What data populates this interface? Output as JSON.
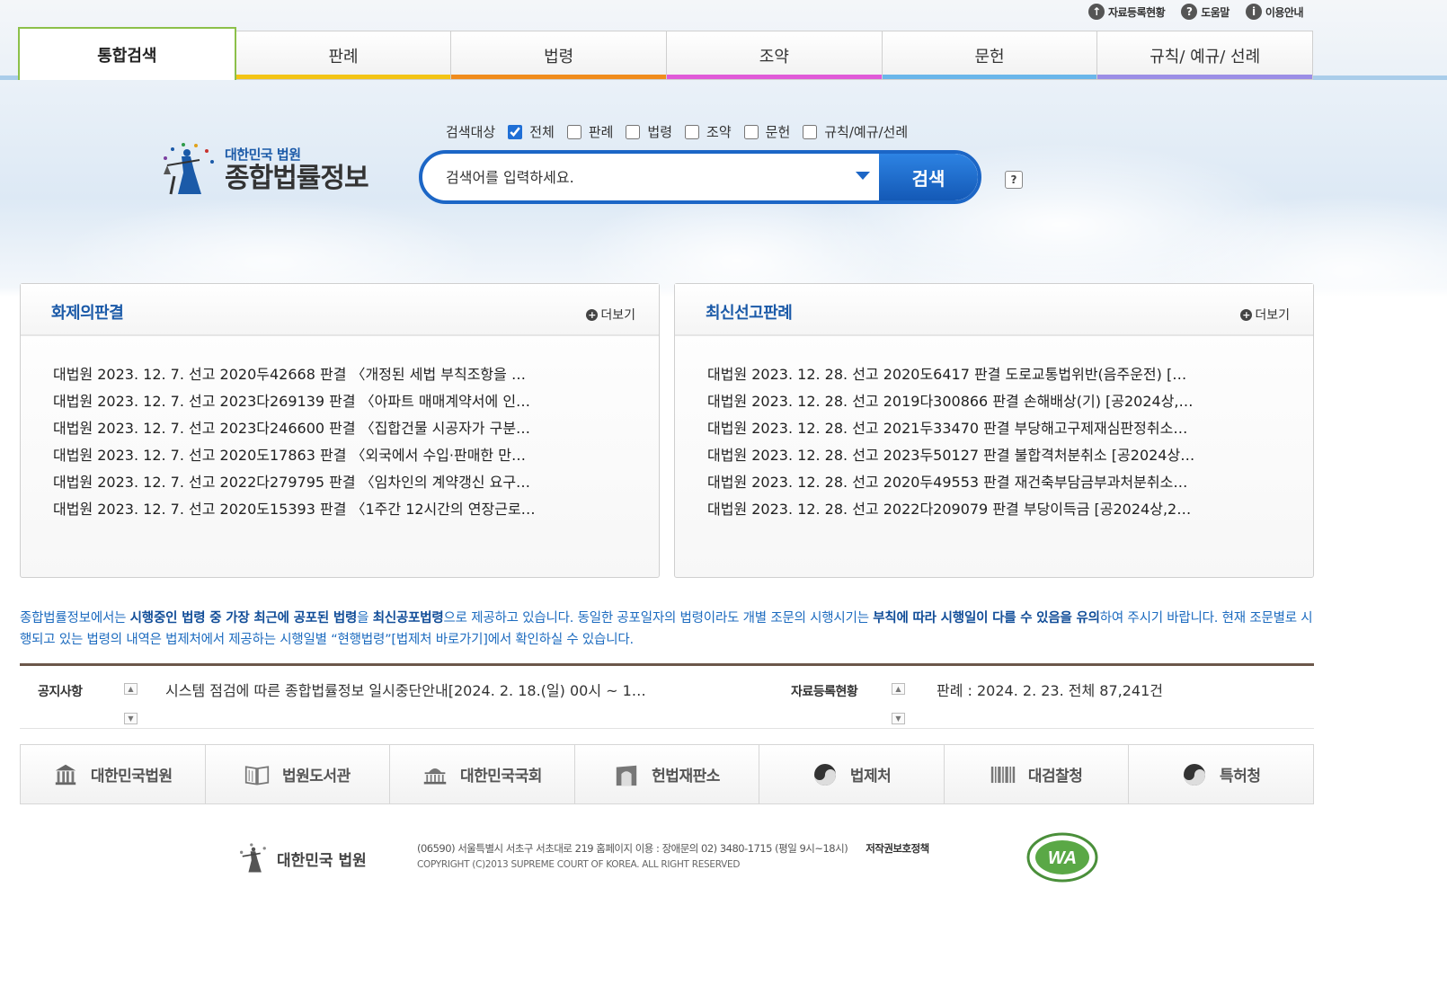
{
  "util": [
    {
      "label": "자료등록현황",
      "icon": "upload-icon"
    },
    {
      "label": "도움말",
      "icon": "question-icon"
    },
    {
      "label": "이용안내",
      "icon": "info-icon"
    }
  ],
  "tabs": [
    {
      "label": "통합검색",
      "color": "#8cc04a",
      "active": true
    },
    {
      "label": "판례",
      "color": "#f3c415"
    },
    {
      "label": "법령",
      "color": "#f08c1c"
    },
    {
      "label": "조약",
      "color": "#e05ad8"
    },
    {
      "label": "문헌",
      "color": "#6ab6ea"
    },
    {
      "label": "규칙/ 예규/ 선례",
      "color": "#9b8ee6"
    }
  ],
  "logo": {
    "sub": "대한민국 법원",
    "main": "종합법률정보"
  },
  "search": {
    "target_label": "검색대상",
    "targets": [
      {
        "label": "전체",
        "checked": true
      },
      {
        "label": "판례",
        "checked": false
      },
      {
        "label": "법령",
        "checked": false
      },
      {
        "label": "조약",
        "checked": false
      },
      {
        "label": "문헌",
        "checked": false
      },
      {
        "label": "규칙/예규/선례",
        "checked": false
      }
    ],
    "placeholder": "검색어를 입력하세요.",
    "button": "검색",
    "help": "?"
  },
  "panels": {
    "topical": {
      "title": "화제의판결",
      "more": "더보기",
      "items": [
        "대법원 2023. 12. 7. 선고 2020두42668 판결 〈개정된 세법 부칙조항을 …",
        "대법원 2023. 12. 7. 선고 2023다269139 판결 〈아파트 매매계약서에 인…",
        "대법원 2023. 12. 7. 선고 2023다246600 판결 〈집합건물 시공자가 구분…",
        "대법원 2023. 12. 7. 선고 2020도17863 판결 〈외국에서 수입·판매한 만…",
        "대법원 2023. 12. 7. 선고 2022다279795 판결 〈임차인의 계약갱신 요구…",
        "대법원 2023. 12. 7. 선고 2020도15393 판결 〈1주간 12시간의 연장근로…"
      ]
    },
    "latest": {
      "title": "최신선고판례",
      "more": "더보기",
      "items": [
        "대법원 2023. 12. 28. 선고 2020도6417 판결 도로교통법위반(음주운전) […",
        "대법원 2023. 12. 28. 선고 2019다300866 판결 손해배상(기) [공2024상,…",
        "대법원 2023. 12. 28. 선고 2021두33470 판결 부당해고구제재심판정취소…",
        "대법원 2023. 12. 28. 선고 2023두50127 판결 불합격처분취소 [공2024상…",
        "대법원 2023. 12. 28. 선고 2020두49553 판결 재건축부담금부과처분취소…",
        "대법원 2023. 12. 28. 선고 2022다209079 판결 부당이득금 [공2024상,2…"
      ]
    }
  },
  "info_text": {
    "p1": "종합법률정보에서는 ",
    "b1": "시행중인 법령 중 가장 최근에 공포된 법령",
    "p2": "을 ",
    "b2": "최신공포법령",
    "p3": "으로 제공하고 있습니다. 동일한 공포일자의 법령이라도 개별 조문의 시행시기는 ",
    "b3": "부칙에 따라 시행일이 다를 수 있음을 유의",
    "p4": "하여 주시기 바랍니다. 현재 조문별로 시행되고 있는 법령의 내역은 법제처에서 제공하는 시행일별 “현행법령”[법제처 바로가기]에서 확인하실 수 있습니다."
  },
  "notices": {
    "notice_label": "공지사항",
    "notice_text": "시스템 점검에 따른 종합법률정보 일시중단안내[2024. 2. 18.(일) 00시 ~ 1…",
    "reg_label": "자료등록현황",
    "reg_text": "판례 : 2024. 2. 23. 전체 87,241건"
  },
  "sites": [
    {
      "label": "대한민국법원",
      "icon": "court-building-icon"
    },
    {
      "label": "법원도서관",
      "icon": "book-icon"
    },
    {
      "label": "대한민국국회",
      "icon": "assembly-building-icon"
    },
    {
      "label": "헌법재판소",
      "icon": "constitutional-court-icon"
    },
    {
      "label": "법제처",
      "icon": "taegeuk-icon"
    },
    {
      "label": "대검찰청",
      "icon": "prosecution-bars-icon"
    },
    {
      "label": "특허청",
      "icon": "taegeuk-icon"
    }
  ],
  "footer": {
    "logo": "대한민국 법원",
    "address": "(06590) 서울특별시 서초구 서초대로 219     홈페이지 이용 : 장애문의 02) 3480-1715 (평일 9시~18시)",
    "policy": "저작권보호정책",
    "copyright": "COPYRIGHT (C)2013 SUPREME COURT OF KOREA.  ALL RIGHT RESERVED",
    "badge": "WA"
  }
}
